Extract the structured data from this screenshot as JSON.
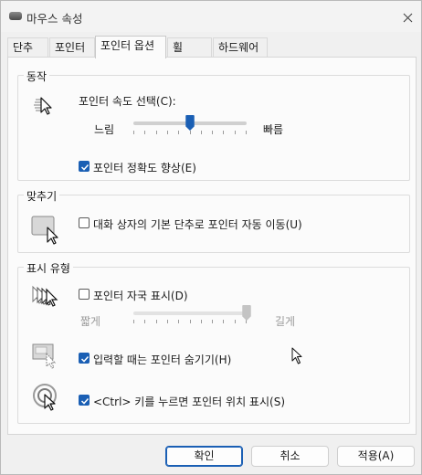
{
  "window": {
    "title": "마우스 속성",
    "close_label": "×"
  },
  "tabs": [
    {
      "label": "단추",
      "active": false
    },
    {
      "label": "포인터",
      "active": false
    },
    {
      "label": "포인터 옵션",
      "active": true
    },
    {
      "label": "휠",
      "active": false
    },
    {
      "label": "하드웨어",
      "active": false
    }
  ],
  "motion": {
    "group_title": "동작",
    "speed_label": "포인터 속도 선택(C):",
    "slow_label": "느림",
    "fast_label": "빠름",
    "speed_value_fraction": 0.5,
    "precision_label": "포인터 정확도 향상(E)",
    "precision_checked": true
  },
  "snap_to": {
    "group_title": "맞추기",
    "snap_label": "대화 상자의 기본 단추로 포인터 자동 이동(U)",
    "snap_checked": false
  },
  "visibility": {
    "group_title": "표시 유형",
    "trails_label": "포인터 자국 표시(D)",
    "trails_checked": false,
    "short_label": "짧게",
    "long_label": "길게",
    "trails_value_fraction": 1.0,
    "hide_label": "입력할 때는 포인터 숨기기(H)",
    "hide_checked": true,
    "ctrl_label": "<Ctrl> 키를 누르면 포인터 위치 표시(S)",
    "ctrl_checked": true
  },
  "buttons": {
    "ok_label": "확인",
    "cancel_label": "취소",
    "apply_label": "적용(A)"
  },
  "colors": {
    "accent": "#1a5fb4",
    "background": "#f0f0f0",
    "panel": "#fbfbfb"
  }
}
